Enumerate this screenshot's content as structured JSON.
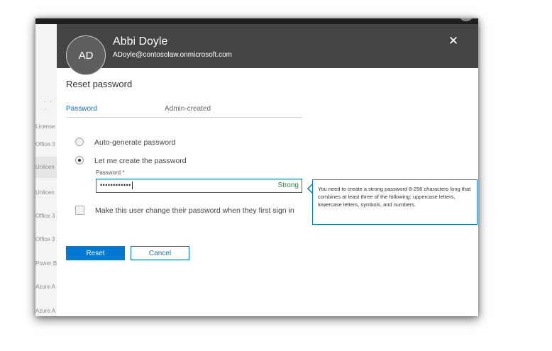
{
  "background_list": {
    "more_glyph": "· · ·",
    "rows": [
      "License",
      "Office 3",
      "Unlicen",
      "Unlicen",
      "Office 3",
      "Office 3",
      "Power B",
      "Azure A",
      "Azure A"
    ]
  },
  "header": {
    "avatar_initials": "AD",
    "name": "Abbi Doyle",
    "email": "ADoyle@contosolaw.onmicrosoft.com",
    "close_glyph": "✕"
  },
  "panel": {
    "title": "Reset password"
  },
  "tabs": [
    {
      "label": "Password",
      "selected": true
    },
    {
      "label": "Admin-created",
      "selected": false
    }
  ],
  "options": {
    "auto_generate_label": "Auto-generate password",
    "manual_label": "Let me create the password",
    "selected": "manual"
  },
  "password_field": {
    "label": "Password",
    "required_mark": "*",
    "masked_value": "••••••••••••",
    "strength": "Strong"
  },
  "tooltip": {
    "text": "You need to create a strong password 8-256 characters long that combines at least three of the following: uppercase letters, lowercase letters, symbols, and numbers."
  },
  "force_change": {
    "label": "Make this user change their password when they first sign in",
    "checked": false
  },
  "buttons": {
    "reset": "Reset",
    "cancel": "Cancel"
  },
  "colors": {
    "accent": "#0078d4",
    "header_bg": "#444444",
    "strength_ok": "#2b8a3e"
  }
}
